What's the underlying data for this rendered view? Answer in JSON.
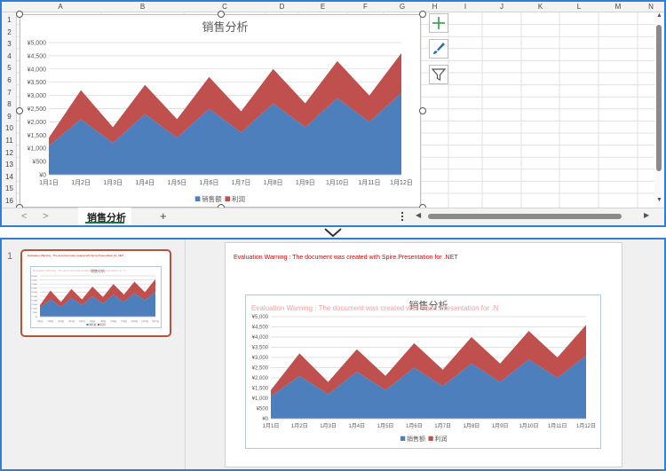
{
  "excel": {
    "columns": [
      "A",
      "B",
      "C",
      "D",
      "E",
      "F",
      "G",
      "H",
      "I",
      "J",
      "K",
      "L",
      "M",
      "N"
    ],
    "rows": [
      "1",
      "2",
      "3",
      "4",
      "5",
      "6",
      "7",
      "8",
      "9",
      "10",
      "11",
      "12",
      "13",
      "14",
      "15",
      "16"
    ],
    "sheet_tab": "销售分析",
    "add_sheet": "+",
    "more_icon": "more-vertical-icon",
    "chart_tools": [
      "plus-icon",
      "brush-icon",
      "filter-icon"
    ]
  },
  "ppt": {
    "slide_number": "1",
    "warning": "Evaluation Warning : The document was created with  Spire.Presentation for .NET",
    "overlay_warning": "Evaluation Warning : The document was created with  Spire.Presentation for .N",
    "thumb_warning": "Evaluation Warning : The document was created with Spire.Presentation for .NET",
    "thumb_overlay_warning": "Evaluation Warning : The document was created with Spire.Presentation for .N"
  },
  "chart_data": [
    {
      "type": "area",
      "stacked": true,
      "title": "销售分析",
      "categories": [
        "1月1日",
        "1月2日",
        "1月3日",
        "1月4日",
        "1月5日",
        "1月6日",
        "1月7日",
        "1月8日",
        "1月9日",
        "1月10日",
        "1月11日",
        "1月12日"
      ],
      "series": [
        {
          "name": "销售额",
          "color": "#4e7fbd",
          "values": [
            1100,
            2100,
            1200,
            2300,
            1400,
            2500,
            1600,
            2700,
            1800,
            2900,
            2000,
            3100
          ]
        },
        {
          "name": "利润",
          "color": "#c0504d",
          "values": [
            300,
            1100,
            600,
            1100,
            700,
            1200,
            800,
            1300,
            900,
            1400,
            1000,
            1500
          ]
        }
      ],
      "y_ticks": [
        "¥0",
        "¥500",
        "¥1,000",
        "¥1,500",
        "¥2,000",
        "¥2,500",
        "¥3,000",
        "¥3,500",
        "¥4,000",
        "¥4,500",
        "¥5,000"
      ],
      "ylim": [
        0,
        5000
      ],
      "grid": true,
      "legend": "bottom"
    },
    {
      "type": "area",
      "stacked": true,
      "title": "销售分析",
      "categories": [
        "1月1日",
        "1月2日",
        "1月3日",
        "1月4日",
        "1月5日",
        "1月6日",
        "1月7日",
        "1月8日",
        "1月9日",
        "1月10日",
        "1月11日",
        "1月12日"
      ],
      "series": [
        {
          "name": "销售额",
          "color": "#4e7fbd",
          "values": [
            1100,
            2100,
            1200,
            2300,
            1400,
            2500,
            1600,
            2700,
            1800,
            2900,
            2000,
            3100
          ]
        },
        {
          "name": "利润",
          "color": "#c0504d",
          "values": [
            300,
            1100,
            600,
            1100,
            700,
            1200,
            800,
            1300,
            900,
            1400,
            1000,
            1500
          ]
        }
      ],
      "y_ticks": [
        "¥0",
        "¥500",
        "¥1,000",
        "¥1,500",
        "¥2,000",
        "¥2,500",
        "¥3,000",
        "¥3,500",
        "¥4,000",
        "¥4,500",
        "¥5,000"
      ],
      "ylim": [
        0,
        5000
      ],
      "grid": true,
      "legend": "bottom"
    }
  ]
}
